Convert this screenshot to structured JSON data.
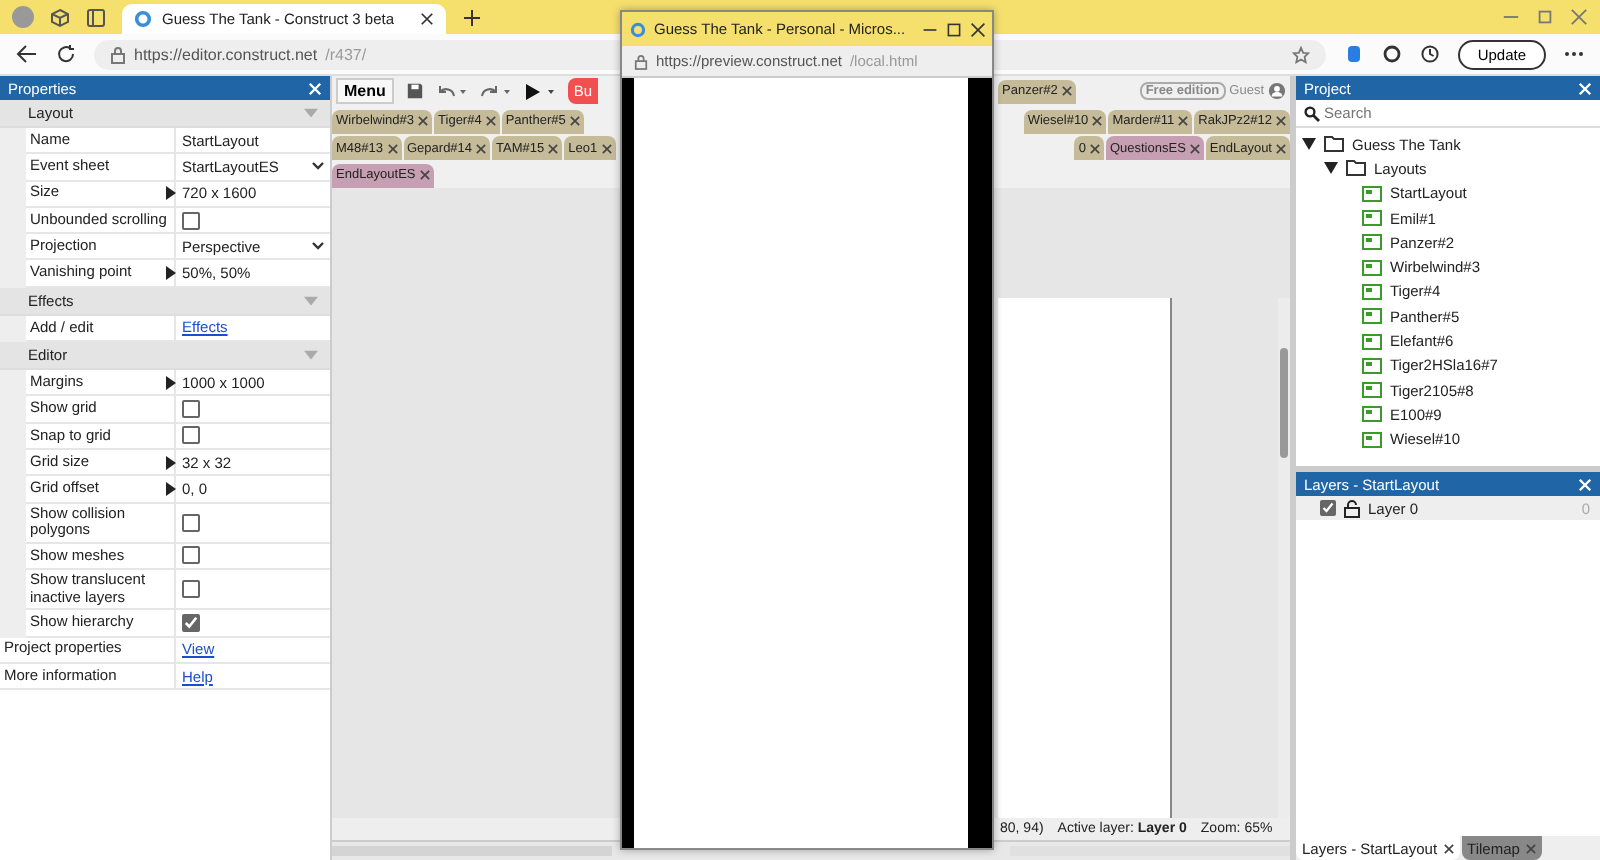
{
  "browser": {
    "tab_title": "Guess The Tank - Construct 3 beta",
    "address_host": "https://editor.construct.net",
    "address_path": "/r437/",
    "update": "Update"
  },
  "properties": {
    "title": "Properties",
    "sections": [
      {
        "title": "Layout",
        "rows": [
          {
            "label": "Name",
            "value": "StartLayout",
            "kind": "text"
          },
          {
            "label": "Event sheet",
            "value": "StartLayoutES",
            "kind": "select"
          },
          {
            "label": "Size",
            "value": "720 x 1600",
            "kind": "expand"
          },
          {
            "label": "Unbounded scrolling",
            "kind": "checkbox",
            "checked": false
          },
          {
            "label": "Projection",
            "value": "Perspective",
            "kind": "select"
          },
          {
            "label": "Vanishing point",
            "value": "50%, 50%",
            "kind": "expand"
          }
        ]
      },
      {
        "title": "Effects",
        "rows": [
          {
            "label": "Add / edit",
            "value": "Effects",
            "kind": "link"
          }
        ]
      },
      {
        "title": "Editor",
        "rows": [
          {
            "label": "Margins",
            "value": "1000 x 1000",
            "kind": "expand"
          },
          {
            "label": "Show grid",
            "kind": "checkbox",
            "checked": false
          },
          {
            "label": "Snap to grid",
            "kind": "checkbox",
            "checked": false
          },
          {
            "label": "Grid size",
            "value": "32 x 32",
            "kind": "expand"
          },
          {
            "label": "Grid offset",
            "value": "0, 0",
            "kind": "expand"
          },
          {
            "label": "Show collision polygons",
            "kind": "checkbox",
            "checked": false
          },
          {
            "label": "Show meshes",
            "kind": "checkbox",
            "checked": false
          },
          {
            "label": "Show translucent inactive layers",
            "kind": "checkbox",
            "checked": false
          },
          {
            "label": "Show hierarchy",
            "kind": "checkbox",
            "checked": true
          }
        ]
      }
    ],
    "footer": [
      {
        "label": "Project properties",
        "value": "View"
      },
      {
        "label": "More information",
        "value": "Help"
      }
    ]
  },
  "toolbar": {
    "menu": "Menu",
    "buy": "Bu",
    "edition": "Free edition",
    "user": "Guest"
  },
  "tab_rows": [
    {
      "left": [],
      "right": [
        {
          "label": "Panzer#2",
          "kind": "layout"
        }
      ]
    },
    {
      "left": [
        {
          "label": "Wirbelwind#3",
          "kind": "layout"
        },
        {
          "label": "Tiger#4",
          "kind": "layout"
        },
        {
          "label": "Panther#5",
          "kind": "layout"
        }
      ],
      "right": [
        {
          "label": "Wiesel#10",
          "kind": "layout"
        },
        {
          "label": "Marder#11",
          "kind": "layout"
        },
        {
          "label": "RakJPz2#12",
          "kind": "layout"
        }
      ]
    },
    {
      "left": [
        {
          "label": "M48#13",
          "kind": "layout"
        },
        {
          "label": "Gepard#14",
          "kind": "layout"
        },
        {
          "label": "TAM#15",
          "kind": "layout"
        },
        {
          "label": "Leo1",
          "kind": "layout"
        }
      ],
      "right": [
        {
          "label": "0",
          "kind": "layout"
        },
        {
          "label": "QuestionsES",
          "kind": "sheet"
        },
        {
          "label": "EndLayout",
          "kind": "layout"
        }
      ]
    },
    {
      "left": [
        {
          "label": "EndLayoutES",
          "kind": "sheet"
        }
      ],
      "right": []
    }
  ],
  "status": {
    "position": "80, 94)",
    "active_label": "Active layer:",
    "active_value": "Layer 0",
    "zoom": "Zoom: 65%"
  },
  "project": {
    "title": "Project",
    "search_placeholder": "Search",
    "tree": [
      {
        "label": "Guess The Tank",
        "kind": "folder",
        "expanded": true,
        "children": [
          {
            "label": "Layouts",
            "kind": "folder",
            "expanded": true,
            "children": [
              {
                "label": "StartLayout",
                "kind": "layout"
              },
              {
                "label": "Emil#1",
                "kind": "layout"
              },
              {
                "label": "Panzer#2",
                "kind": "layout"
              },
              {
                "label": "Wirbelwind#3",
                "kind": "layout"
              },
              {
                "label": "Tiger#4",
                "kind": "layout"
              },
              {
                "label": "Panther#5",
                "kind": "layout"
              },
              {
                "label": "Elefant#6",
                "kind": "layout"
              },
              {
                "label": "Tiger2HSla16#7",
                "kind": "layout"
              },
              {
                "label": "Tiger2105#8",
                "kind": "layout"
              },
              {
                "label": "E100#9",
                "kind": "layout"
              },
              {
                "label": "Wiesel#10",
                "kind": "layout"
              }
            ]
          }
        ]
      }
    ]
  },
  "layers": {
    "title": "Layers - StartLayout",
    "items": [
      {
        "name": "Layer 0",
        "visible": true,
        "count": "0"
      }
    ]
  },
  "bottom_tabs": [
    {
      "label": "Layers - StartLayout",
      "selected": true
    },
    {
      "label": "Tilemap",
      "selected": false
    }
  ],
  "preview": {
    "title": "Guess The Tank - Personal - Micros...",
    "address_host": "https://preview.construct.net",
    "address_path": "/local.html"
  }
}
